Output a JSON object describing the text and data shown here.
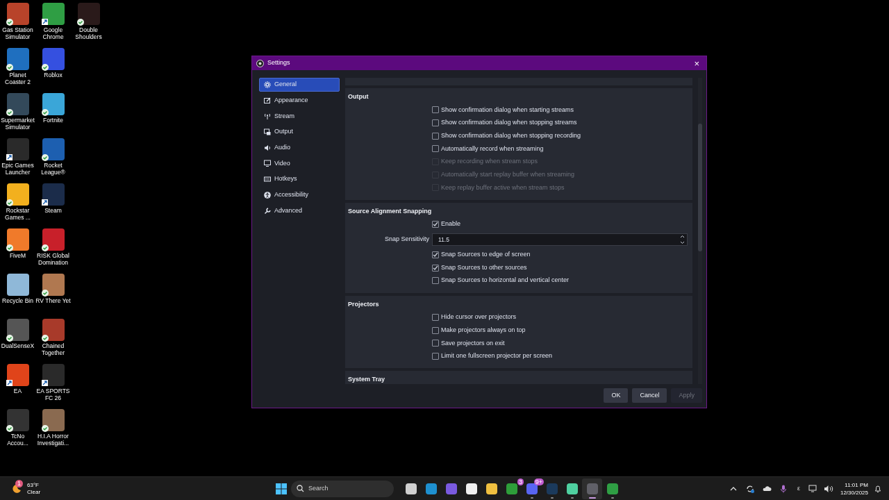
{
  "desktop_icons": [
    [
      {
        "label": "Gas Station Simulator",
        "color": "#b8432a",
        "synced": true,
        "shortcut": false
      },
      {
        "label": "Google Chrome",
        "color": "#2f9e44",
        "synced": false,
        "shortcut": true
      },
      {
        "label": "Double Shoulders",
        "color": "#2a1a1a",
        "synced": true,
        "shortcut": false
      }
    ],
    [
      {
        "label": "Planet Coaster 2",
        "color": "#1f6fbf",
        "synced": true,
        "shortcut": false
      },
      {
        "label": "Roblox",
        "color": "#3550e0",
        "synced": true,
        "shortcut": false
      }
    ],
    [
      {
        "label": "Supermarket Simulator",
        "color": "#33495a",
        "synced": true,
        "shortcut": false
      },
      {
        "label": "Fortnite",
        "color": "#3aa6d8",
        "synced": true,
        "shortcut": false
      }
    ],
    [
      {
        "label": "Epic Games Launcher",
        "color": "#2a2a2a",
        "synced": false,
        "shortcut": true
      },
      {
        "label": "Rocket League®",
        "color": "#1d5fb0",
        "synced": true,
        "shortcut": false
      }
    ],
    [
      {
        "label": "Rockstar Games ...",
        "color": "#f2b01e",
        "synced": true,
        "shortcut": false
      },
      {
        "label": "Steam",
        "color": "#1b2c4a",
        "synced": false,
        "shortcut": true
      }
    ],
    [
      {
        "label": "FiveM",
        "color": "#f07a2a",
        "synced": true,
        "shortcut": false
      },
      {
        "label": "RISK Global Domination",
        "color": "#c8202a",
        "synced": true,
        "shortcut": false
      }
    ],
    [
      {
        "label": "Recycle Bin",
        "color": "#8fb8d8",
        "synced": false,
        "shortcut": false
      },
      {
        "label": "RV There Yet",
        "color": "#b07850",
        "synced": true,
        "shortcut": false
      }
    ],
    [
      {
        "label": "DualSenseX",
        "color": "#555555",
        "synced": true,
        "shortcut": false
      },
      {
        "label": "Chained Together",
        "color": "#a83a2a",
        "synced": true,
        "shortcut": false
      }
    ],
    [
      {
        "label": "EA",
        "color": "#e0441a",
        "synced": false,
        "shortcut": true
      },
      {
        "label": "EA SPORTS FC 26",
        "color": "#2a2a2a",
        "synced": false,
        "shortcut": true
      }
    ],
    [
      {
        "label": "TcNo Accou...",
        "color": "#333333",
        "synced": true,
        "shortcut": false
      },
      {
        "label": "H.I.A Horror Investigati...",
        "color": "#8a6a50",
        "synced": true,
        "shortcut": false
      }
    ]
  ],
  "window": {
    "title": "Settings",
    "close": "×",
    "sidebar": [
      {
        "label": "General",
        "selected": true
      },
      {
        "label": "Appearance",
        "selected": false
      },
      {
        "label": "Stream",
        "selected": false
      },
      {
        "label": "Output",
        "selected": false
      },
      {
        "label": "Audio",
        "selected": false
      },
      {
        "label": "Video",
        "selected": false
      },
      {
        "label": "Hotkeys",
        "selected": false
      },
      {
        "label": "Accessibility",
        "selected": false
      },
      {
        "label": "Advanced",
        "selected": false
      }
    ],
    "sections": [
      {
        "title": "Output",
        "rows": [
          {
            "kind": "checkbox",
            "label": "Show confirmation dialog when starting streams",
            "checked": false,
            "disabled": false
          },
          {
            "kind": "checkbox",
            "label": "Show confirmation dialog when stopping streams",
            "checked": false,
            "disabled": false
          },
          {
            "kind": "checkbox",
            "label": "Show confirmation dialog when stopping recording",
            "checked": false,
            "disabled": false
          },
          {
            "kind": "checkbox",
            "label": "Automatically record when streaming",
            "checked": false,
            "disabled": false
          },
          {
            "kind": "checkbox",
            "label": "Keep recording when stream stops",
            "checked": false,
            "disabled": true
          },
          {
            "kind": "checkbox",
            "label": "Automatically start replay buffer when streaming",
            "checked": false,
            "disabled": true
          },
          {
            "kind": "checkbox",
            "label": "Keep replay buffer active when stream stops",
            "checked": false,
            "disabled": true
          }
        ]
      },
      {
        "title": "Source Alignment Snapping",
        "rows": [
          {
            "kind": "checkbox",
            "label": "Enable",
            "checked": true,
            "disabled": false
          },
          {
            "kind": "spin",
            "label": "Snap Sensitivity",
            "value": "11.5"
          },
          {
            "kind": "checkbox",
            "label": "Snap Sources to edge of screen",
            "checked": true,
            "disabled": false
          },
          {
            "kind": "checkbox",
            "label": "Snap Sources to other sources",
            "checked": true,
            "disabled": false
          },
          {
            "kind": "checkbox",
            "label": "Snap Sources to horizontal and vertical center",
            "checked": false,
            "disabled": false
          }
        ]
      },
      {
        "title": "Projectors",
        "rows": [
          {
            "kind": "checkbox",
            "label": "Hide cursor over projectors",
            "checked": false,
            "disabled": false
          },
          {
            "kind": "checkbox",
            "label": "Make projectors always on top",
            "checked": false,
            "disabled": false
          },
          {
            "kind": "checkbox",
            "label": "Save projectors on exit",
            "checked": false,
            "disabled": false
          },
          {
            "kind": "checkbox",
            "label": "Limit one fullscreen projector per screen",
            "checked": false,
            "disabled": false
          }
        ]
      },
      {
        "title": "System Tray"
      }
    ],
    "buttons": [
      {
        "label": "OK",
        "disabled": false
      },
      {
        "label": "Cancel",
        "disabled": false
      },
      {
        "label": "Apply",
        "disabled": true
      }
    ]
  },
  "taskbar": {
    "weather": {
      "temperature": "63°F",
      "condition": "Clear",
      "badge": "1"
    },
    "search": {
      "placeholder": "Search"
    },
    "apps": [
      {
        "color": "#d0d0d0",
        "running": false,
        "active": false
      },
      {
        "color": "#1e90d0",
        "running": false,
        "active": false
      },
      {
        "color": "#7a5ae0",
        "running": false,
        "active": false
      },
      {
        "color": "#f0f0f0",
        "running": false,
        "active": false
      },
      {
        "color": "#f0c040",
        "running": false,
        "active": false
      },
      {
        "color": "#2e9e3a",
        "running": false,
        "active": false,
        "badge": "3"
      },
      {
        "color": "#5865f2",
        "running": true,
        "active": false,
        "badge": "9+"
      },
      {
        "color": "#1b3a5c",
        "running": true,
        "active": false
      },
      {
        "color": "#4fd0a0",
        "running": true,
        "active": false
      },
      {
        "color": "#606068",
        "running": true,
        "active": true
      },
      {
        "color": "#2f9e44",
        "running": true,
        "active": false
      }
    ],
    "tray_text": "ε",
    "time": "11:01 PM",
    "date": "12/30/2025"
  }
}
